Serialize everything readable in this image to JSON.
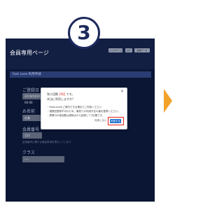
{
  "step": {
    "number": "3"
  },
  "header": {
    "title": "会員専用ページ",
    "buttons": [
      "トップページ",
      "ログ",
      "会員データ"
    ]
  },
  "section": {
    "title": "Fast Lane 利用申請"
  },
  "form": {
    "field1": {
      "label": "ご登録日",
      "value": "2019/04/01 00:00"
    },
    "field2": {
      "label": "お名前",
      "value": "佐藤"
    },
    "field3": {
      "label": "会員番号",
      "value": "123"
    },
    "note": "会員番号に関する補足事項を表示しています",
    "field4": {
      "label": "クラス",
      "value": "----"
    }
  },
  "modal": {
    "line1_prefix": "残り回数 ",
    "line1_highlight": "20回",
    "line1_suffix": " です。",
    "line2": "本当に利用しますか？",
    "notes": [
      "・FastLaneのご案内できる場合でご利用ください",
      "・複数回登録不可のため、最低での利用予定の番を登録ください。",
      "・昇降口の他回数は現時点から起算して3日間です。"
    ],
    "cancel_label": "利用しない",
    "ok_label": "利用する"
  },
  "colors": {
    "accent": "#e3231a",
    "primary_button": "#1f6fd1",
    "screen_bg": "#0d1a3b",
    "arrow": "#f2a22b"
  }
}
